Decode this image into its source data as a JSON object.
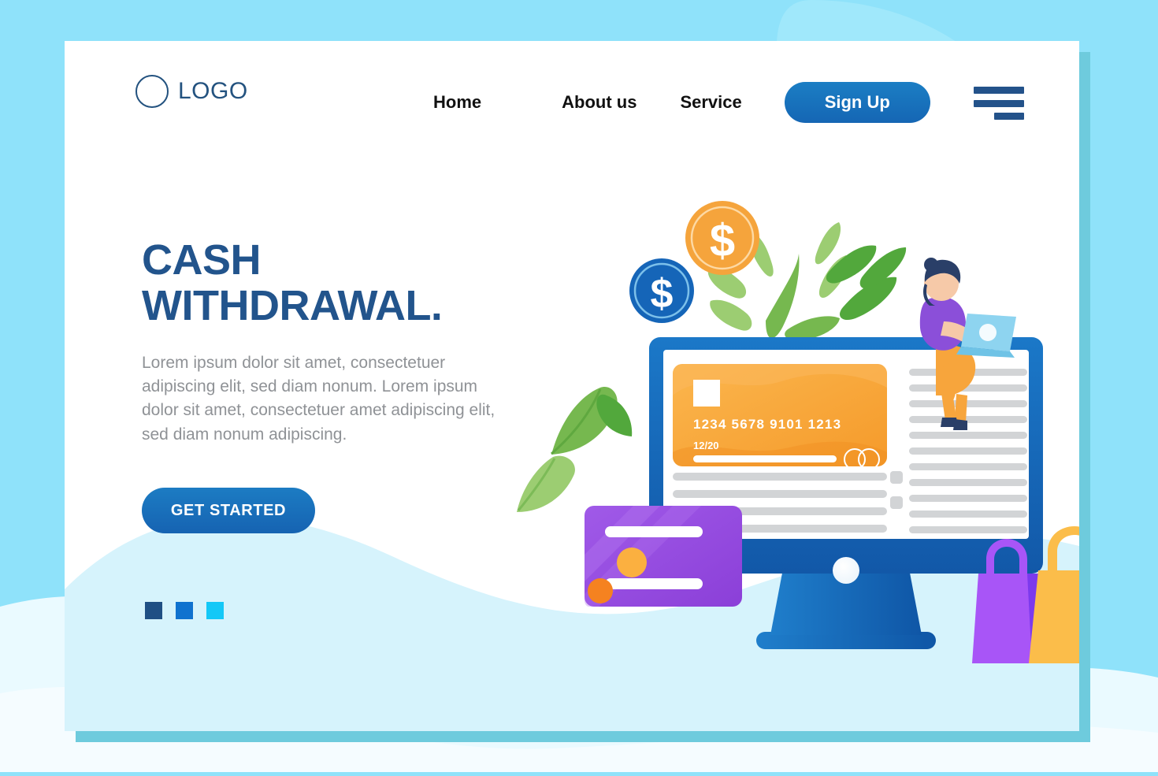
{
  "page": {
    "background_color": "#8fe2fa",
    "card_background": "#ffffff",
    "card_shadow_color": "#6ecbdd",
    "wave_color": "#d6f3fc"
  },
  "navbar": {
    "logo": {
      "icon": "circle-outline-icon",
      "text": "LOGO",
      "color": "#23527f"
    },
    "links": [
      {
        "label": "Home"
      },
      {
        "label": "About us"
      },
      {
        "label": "Service"
      }
    ],
    "signup": {
      "label": "Sign Up",
      "color": "#1566b4",
      "text_color": "#ffffff"
    },
    "menu_icon": "hamburger-menu-icon",
    "menu_color": "#23528a"
  },
  "hero": {
    "headline_line1": "CASH",
    "headline_line2": "WITHDRAWAL.",
    "headline_color": "#22548c",
    "paragraph": "Lorem ipsum dolor sit amet, consectetuer adipiscing elit, sed diam nonum. Lorem ipsum dolor sit amet, consectetuer amet adipiscing elit, sed diam nonum adipiscing.",
    "paragraph_color": "#8f9296",
    "cta": {
      "label": "GET STARTED",
      "color": "#1663b2",
      "text_color": "#ffffff"
    },
    "pagination_dots": [
      {
        "name": "dot-1",
        "color": "#1f4f84"
      },
      {
        "name": "dot-2",
        "color": "#0f72cf"
      },
      {
        "name": "dot-3",
        "color": "#14c8f7"
      }
    ]
  },
  "illustration": {
    "monitor": {
      "frame_color": "#1465b9",
      "screen_color": "#ffffff",
      "stand_color": "#1566b5",
      "power_button_color": "#f7fbff"
    },
    "credit_card_front": {
      "color": "#f7a93b",
      "number": "1234  5678  9101  1213",
      "expiry": "12/20",
      "chip_color": "#ffffff",
      "logo": "double-circle-icon"
    },
    "credit_card_purple": {
      "color": "#9b4ee0",
      "accent_color": "#7a3fd0",
      "dot_colors": [
        "#fbb040",
        "#f58220"
      ]
    },
    "coins": [
      {
        "name": "coin-orange",
        "symbol": "$",
        "color": "#f5a43c"
      },
      {
        "name": "coin-blue",
        "symbol": "$",
        "color": "#1565b8"
      }
    ],
    "person": {
      "name": "woman-with-laptop",
      "hair_color": "#2a3f68",
      "skin_color": "#f6c9a8",
      "shirt_color": "#8b4fd9",
      "pants_color": "#f7a53c",
      "laptop_color": "#8ed4f0"
    },
    "shopping_bags": [
      {
        "name": "bag-purple",
        "color": "#a855f7",
        "side_color": "#7c3aed"
      },
      {
        "name": "bag-orange",
        "color": "#fbbd4a",
        "side_color": "#f58220"
      }
    ],
    "leaves": {
      "light_green": "#8cc765",
      "mid_green": "#76b84f",
      "dark_green": "#52a83c"
    },
    "content_lines_color": "#d2d4d6"
  }
}
